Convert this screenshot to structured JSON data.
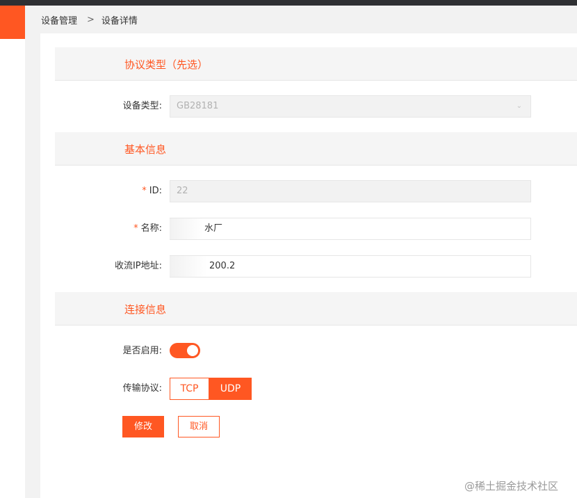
{
  "breadcrumb": {
    "parent": "设备管理",
    "separator": ">",
    "current": "设备详情"
  },
  "sections": {
    "protocol": "协议类型（先选）",
    "basic": "基本信息",
    "connection": "连接信息"
  },
  "form": {
    "device_type": {
      "label": "设备类型:",
      "value": "GB28181"
    },
    "id": {
      "label": "ID:",
      "required_mark": "*",
      "value": "22"
    },
    "name": {
      "label": "名称:",
      "required_mark": "*",
      "value": "水厂"
    },
    "stream_ip": {
      "label": "收流IP地址:",
      "value": "200.2"
    },
    "enabled": {
      "label": "是否启用:",
      "on": true
    },
    "transport": {
      "label": "传输协议:",
      "options": [
        "TCP",
        "UDP"
      ],
      "selected": "UDP"
    }
  },
  "buttons": {
    "modify": "修改",
    "cancel": "取消"
  },
  "watermark": "@稀土掘金技术社区",
  "colors": {
    "accent": "#ff5722",
    "topbar": "#2f3033"
  }
}
